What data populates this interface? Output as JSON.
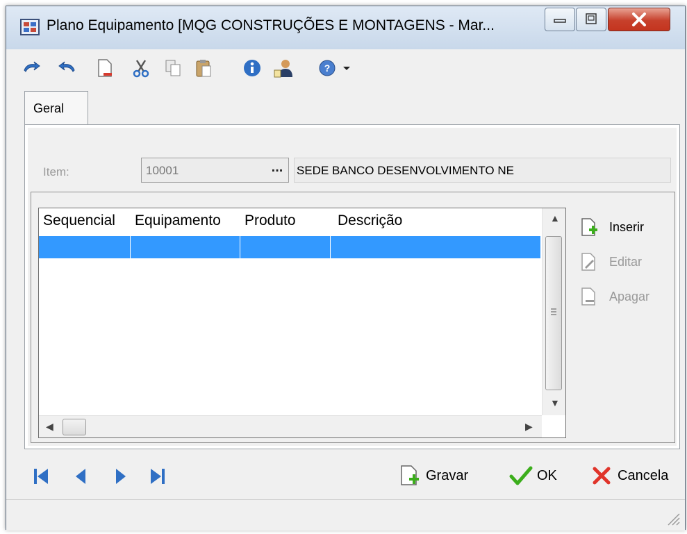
{
  "window": {
    "title": "Plano Equipamento [MQG CONSTRUÇÕES E MONTAGENS - Mar...",
    "buttons": {
      "minimize": "minimize",
      "maximize": "maximize",
      "close": "close"
    }
  },
  "toolbar": {
    "items": [
      {
        "icon": "undo-icon"
      },
      {
        "icon": "redo-icon"
      },
      {
        "icon": "new-document-icon"
      },
      {
        "icon": "cut-icon"
      },
      {
        "icon": "copy-icon"
      },
      {
        "icon": "paste-icon"
      },
      {
        "icon": "info-icon"
      },
      {
        "icon": "user-icon"
      },
      {
        "icon": "help-icon"
      }
    ]
  },
  "tabs": [
    {
      "label": "Geral",
      "active": true
    }
  ],
  "form": {
    "item_label": "Item:",
    "item_code": "10001",
    "item_lookup": "...",
    "item_description": "SEDE BANCO DESENVOLVIMENTO NE"
  },
  "grid": {
    "columns": [
      "Sequencial",
      "Equipamento",
      "Produto",
      "Descrição"
    ],
    "rows": [
      {
        "selected": true,
        "cells": [
          "",
          "",
          "",
          ""
        ]
      }
    ]
  },
  "side_actions": {
    "insert": "Inserir",
    "edit": "Editar",
    "delete": "Apagar"
  },
  "footer": {
    "save": "Gravar",
    "ok": "OK",
    "cancel": "Cancela"
  },
  "colors": {
    "selection": "#3399ff",
    "ok_green": "#3cae1c",
    "cancel_red": "#e0342a",
    "nav_blue": "#2f6fc4"
  }
}
